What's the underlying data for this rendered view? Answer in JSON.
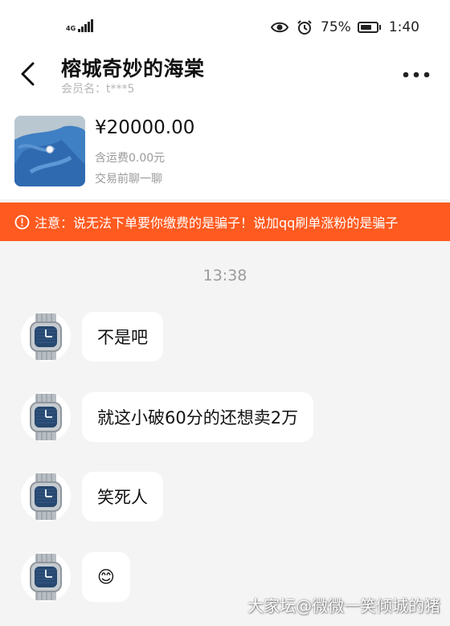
{
  "status_bar": {
    "network": "4G",
    "battery_percent": "75%",
    "battery_level": 0.75,
    "time": "1:40"
  },
  "header": {
    "title": "榕城奇妙的海棠",
    "member_label": "会员名：",
    "member_name": "t***5"
  },
  "product": {
    "price": "¥20000.00",
    "shipping": "含运费0.00元",
    "chat_hint": "交易前聊一聊"
  },
  "warning": {
    "text": "注意：说无法下单要你缴费的是骗子！说加qq刷单涨粉的是骗子"
  },
  "conversation": {
    "timestamp": "13:38",
    "messages": [
      {
        "text": "不是吧"
      },
      {
        "text": "就这小破60分的还想卖2万"
      },
      {
        "text": "笑死人"
      },
      {
        "text": "😊"
      }
    ]
  },
  "watermark": "大家坛@微微一笑倾城的猪",
  "icons": {
    "back": "chevron-left-icon",
    "more": "more-dots-icon",
    "eye": "eye-icon",
    "alarm": "alarm-icon",
    "warning": "info-circle-icon"
  }
}
